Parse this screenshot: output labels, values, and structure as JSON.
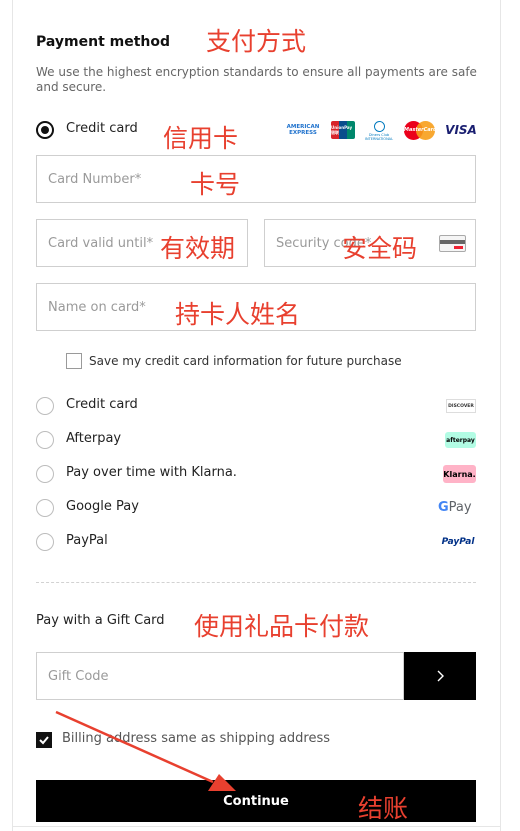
{
  "payment": {
    "title": "Payment method",
    "description": "We use the highest encryption standards to ensure all payments are safe and secure.",
    "credit_card_label": "Credit card",
    "card_number_placeholder": "Card Number*",
    "card_valid_placeholder": "Card valid until*",
    "security_code_placeholder": "Security code*",
    "name_on_card_placeholder": "Name on card*",
    "save_card_label": "Save my credit card information for future purchase",
    "card_logos": {
      "amex": "AMERICAN EXPRESS",
      "unionpay": "UnionPay 银联",
      "diners": "Diners Club INTERNATIONAL",
      "mastercard": "MasterCard",
      "visa": "VISA"
    },
    "other_options": [
      {
        "label": "Credit card",
        "logo": "DISCOVER"
      },
      {
        "label": "Afterpay",
        "logo": "afterpay"
      },
      {
        "label": "Pay over time with Klarna.",
        "logo": "Klarna."
      },
      {
        "label": "Google Pay",
        "logo_g": "G",
        "logo_pay": "Pay"
      },
      {
        "label": "PayPal",
        "logo": "PayPal"
      }
    ]
  },
  "gift": {
    "label": "Pay with a Gift Card",
    "placeholder": "Gift Code"
  },
  "billing_same_label": "Billing address same as shipping address",
  "continue_label": "Continue",
  "annotations": {
    "payment_method": "支付方式",
    "credit_card": "信用卡",
    "card_number": "卡号",
    "valid": "有效期",
    "security": "安全码",
    "holder": "持卡人姓名",
    "gift": "使用礼品卡付款",
    "checkout": "结账"
  },
  "colors": {
    "annotation": "#e8402f",
    "primary": "#000000",
    "afterpay": "#b2fce4",
    "klarna": "#ffb3c7",
    "paypal": "#003087"
  }
}
